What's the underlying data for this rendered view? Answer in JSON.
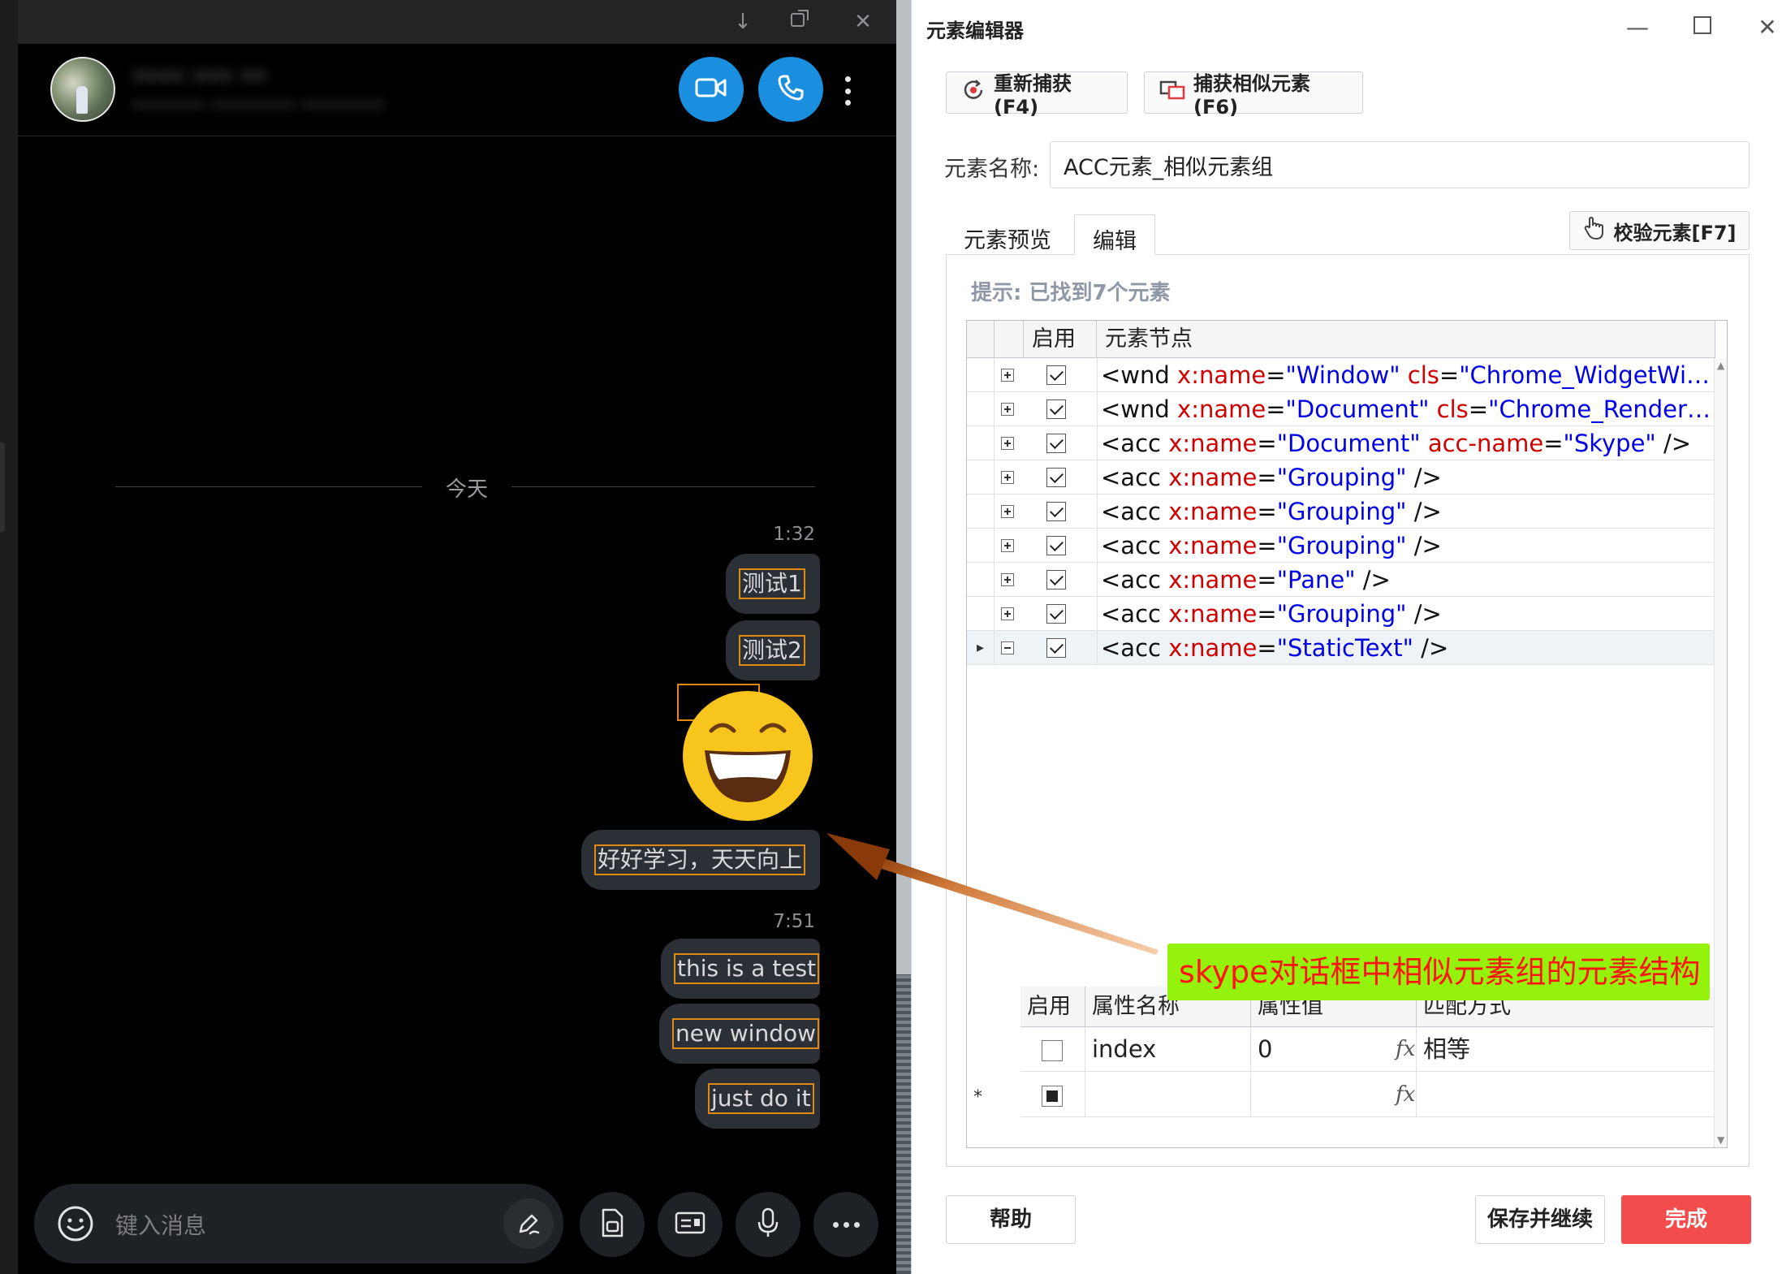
{
  "skype": {
    "header": {
      "contact_name": "•••• ••• ••",
      "contact_status": "••••••• •••••••• ••••••••"
    },
    "day_separator": "今天",
    "groups": [
      {
        "time": "1:32",
        "messages": [
          "测试1",
          "测试2",
          "",
          "好好学习，天天向上"
        ]
      },
      {
        "time": "7:51",
        "messages": [
          "this is  a test",
          "new window",
          "just do it"
        ]
      }
    ],
    "composer": {
      "placeholder": "键入消息"
    },
    "icons": {
      "video": "video-icon",
      "call": "phone-icon",
      "more": "more-icon",
      "emoji": "emoji-icon",
      "pen": "pen-icon",
      "file": "file-icon",
      "contact_card": "contact-card-icon",
      "mic": "microphone-icon",
      "options": "options-icon"
    },
    "accent_color": "#1a8fe0",
    "highlight_color": "#e08a12"
  },
  "editor": {
    "title": "元素编辑器",
    "recapture_button": "重新捕获(F4)",
    "capture_similar_button": "捕获相似元素(F6)",
    "name_label": "元素名称:",
    "name_value": "ACC元素_相似元素组",
    "tabs": [
      "元素预览",
      "编辑"
    ],
    "verify_button": "校验元素[F7]",
    "hint": "提示: 已找到7个元素",
    "columns": {
      "enabled": "启用",
      "node": "元素节点"
    },
    "nodes": [
      {
        "tag": "<wnd ",
        "a1": "x:name",
        "v1": "\"Window\"",
        "a2": "cls",
        "v2": "\"Chrome_WidgetWi…",
        "tail": ""
      },
      {
        "tag": "<wnd ",
        "a1": "x:name",
        "v1": "\"Document\"",
        "a2": "cls",
        "v2": "\"Chrome_Render…",
        "tail": ""
      },
      {
        "tag": "<acc ",
        "a1": "x:name",
        "v1": "\"Document\"",
        "a2": "acc-name",
        "v2": "\"Skype\"",
        "tail": " />"
      },
      {
        "tag": "<acc ",
        "a1": "x:name",
        "v1": "\"Grouping\"",
        "a2": "",
        "v2": "",
        "tail": " />"
      },
      {
        "tag": "<acc ",
        "a1": "x:name",
        "v1": "\"Grouping\"",
        "a2": "",
        "v2": "",
        "tail": " />"
      },
      {
        "tag": "<acc ",
        "a1": "x:name",
        "v1": "\"Grouping\"",
        "a2": "",
        "v2": "",
        "tail": " />"
      },
      {
        "tag": "<acc ",
        "a1": "x:name",
        "v1": "\"Pane\"",
        "a2": "",
        "v2": "",
        "tail": " />"
      },
      {
        "tag": "<acc ",
        "a1": "x:name",
        "v1": "\"Grouping\"",
        "a2": "",
        "v2": "",
        "tail": " />"
      },
      {
        "tag": "<acc ",
        "a1": "x:name",
        "v1": "\"StaticText\"",
        "a2": "",
        "v2": "",
        "tail": " />"
      }
    ],
    "attr_columns": {
      "enabled": "启用",
      "name": "属性名称",
      "value": "属性值",
      "match": "匹配方式"
    },
    "attributes": [
      {
        "name": "index",
        "value": "0",
        "match": "相等",
        "fx": "fx"
      }
    ],
    "new_row_marker": "*",
    "new_row_fx": "fx",
    "help_button": "帮助",
    "save_continue_button": "保存并继续",
    "done_button": "完成",
    "primary_color": "#f24c4c",
    "attr_color": "#d00000",
    "value_color": "#0000e6"
  },
  "annotation": {
    "text": "skype对话框中相似元素组的元素结构",
    "background": "#95f20c",
    "text_color": "#ff1414"
  }
}
